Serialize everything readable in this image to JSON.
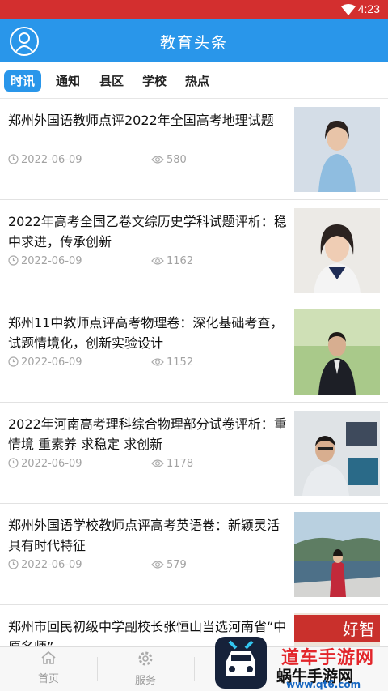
{
  "status_bar": {
    "time": "4:23"
  },
  "header": {
    "title": "教育头条"
  },
  "tabs": [
    {
      "label": "时讯",
      "active": true
    },
    {
      "label": "通知",
      "active": false
    },
    {
      "label": "县区",
      "active": false
    },
    {
      "label": "学校",
      "active": false
    },
    {
      "label": "热点",
      "active": false
    }
  ],
  "articles": [
    {
      "title": "郑州外国语教师点评2022年全国高考地理试题",
      "date": "2022-06-09",
      "views": "580"
    },
    {
      "title": "2022年高考全国乙卷文综历史学科试题评析：稳中求进，传承创新",
      "date": "2022-06-09",
      "views": "1162"
    },
    {
      "title": "郑州11中教师点评高考物理卷：深化基础考查，试题情境化，创新实验设计",
      "date": "2022-06-09",
      "views": "1152"
    },
    {
      "title": "2022年河南高考理科综合物理部分试卷评析：重情境 重素养 求稳定 求创新",
      "date": "2022-06-09",
      "views": "1178"
    },
    {
      "title": "郑州外国语学校教师点评高考英语卷：新颖灵活具有时代特征",
      "date": "2022-06-09",
      "views": "579"
    },
    {
      "title": "郑州市回民初级中学副校长张恒山当选河南省“中原名师”",
      "date": "",
      "views": ""
    }
  ],
  "thumb_caption": "好智",
  "bottom_nav": [
    {
      "label": "首页",
      "icon": "home-icon"
    },
    {
      "label": "服务",
      "icon": "gear-icon"
    }
  ],
  "watermark": {
    "line1": "道车手游网",
    "line2": "蜗牛手游网",
    "line3": "www.qt6.com"
  },
  "colors": {
    "status_bar": "#d32f2f",
    "app_bar": "#2996ea",
    "tab_active": "#2996ea",
    "meta_text": "#a3a3a3"
  }
}
